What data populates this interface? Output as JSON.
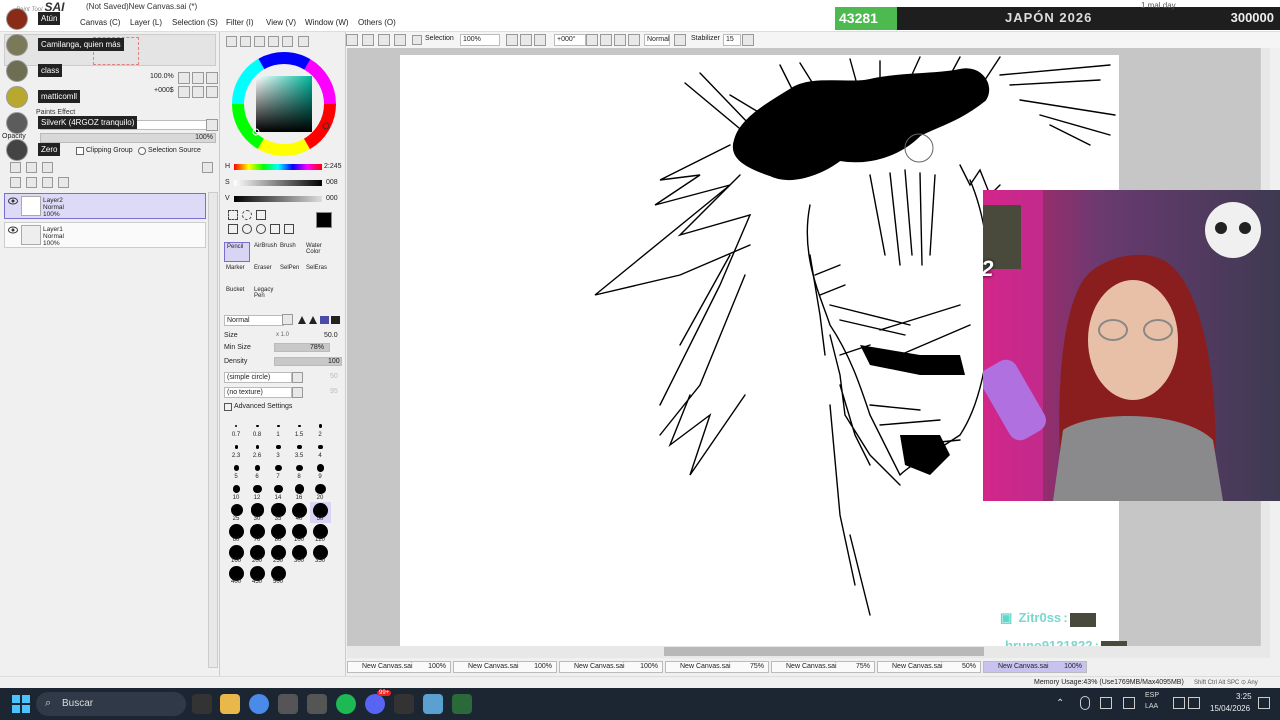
{
  "app": {
    "name": "SAI",
    "name_prefix": "Paint Tool",
    "title": "(Not Saved)New Canvas.sai (*)"
  },
  "menu": [
    "Canvas (C)",
    "Layer (L)",
    "Selection (S)",
    "Filter (I)",
    "View (V)",
    "Window (W)",
    "Others (O)"
  ],
  "overlay": {
    "count": "43281",
    "title": "JAPÓN 2026",
    "goal": "300000",
    "time_hint": "1 mal day"
  },
  "chat_names": [
    "Atún",
    "Camilanga, quien más",
    "class",
    "matticomll",
    "SilverK (4RGOZ tranquilo)",
    "Zero"
  ],
  "chat_feed": [
    {
      "name": "Zitr0ss"
    },
    {
      "name": "bruno9121822"
    }
  ],
  "combo_badge": "x2",
  "toolbar": {
    "selection_label": "Selection",
    "zoom": "100%",
    "rotation": "+000°",
    "blend": "Normal",
    "stabilizer_label": "Stabilizer",
    "stabilizer_value": "15"
  },
  "nav": {
    "zoom_value": "100.0%",
    "angle_value": "+000$",
    "opacity_label": "Opacity",
    "opacity_value": "100%",
    "effect_label": "Paints Effect",
    "clipping_label": "Clipping Group",
    "selection_source_label": "Selection Source"
  },
  "layers": [
    {
      "name": "Layer2",
      "mode": "Normal",
      "opacity": "100%",
      "active": true
    },
    {
      "name": "Layer1",
      "mode": "Normal",
      "opacity": "100%",
      "active": false
    }
  ],
  "color": {
    "h_label": "H",
    "h_value": "2:245",
    "s_label": "S",
    "s_value": "008",
    "v_label": "V",
    "v_value": "000",
    "current": "#000000"
  },
  "tools": [
    "Pencil",
    "AirBrush",
    "Brush",
    "Water Color",
    "Marker",
    "Eraser",
    "SelPen",
    "SelEras",
    "Bucket",
    "Legacy Pen"
  ],
  "brush": {
    "blend": "Normal",
    "size_label": "Size",
    "size_mult": "x 1.0",
    "size_value": "50.0",
    "min_size_label": "Min Size",
    "min_size_value": "78%",
    "density_label": "Density",
    "density_value": "100",
    "shape": "(simple circle)",
    "shape_value": "50",
    "texture": "(no texture)",
    "texture_value": "95",
    "advanced_label": "Advanced Settings"
  },
  "brush_sizes": [
    "0.7",
    "0.8",
    "1",
    "1.5",
    "2",
    "2.3",
    "2.6",
    "3",
    "3.5",
    "4",
    "5",
    "6",
    "7",
    "8",
    "9",
    "10",
    "12",
    "14",
    "16",
    "20",
    "25",
    "30",
    "35",
    "40",
    "50",
    "60",
    "70",
    "80",
    "100",
    "120",
    "160",
    "200",
    "250",
    "300",
    "350",
    "400",
    "450",
    "500"
  ],
  "canvas_tabs": [
    {
      "name": "New Canvas.sai",
      "zoom": "100%"
    },
    {
      "name": "New Canvas.sai",
      "zoom": "100%"
    },
    {
      "name": "New Canvas.sai",
      "zoom": "100%"
    },
    {
      "name": "New Canvas.sai",
      "zoom": "75%"
    },
    {
      "name": "New Canvas.sai",
      "zoom": "75%"
    },
    {
      "name": "New Canvas.sai",
      "zoom": "50%"
    },
    {
      "name": "New Canvas.sai",
      "zoom": "100%",
      "active": true
    }
  ],
  "status": {
    "memory": "Memory Usage:43% (Use1769MB/Max4095MB)",
    "keys": "Shift Ctrl Alt SPC ⊙ Any"
  },
  "taskbar": {
    "search": "Buscar",
    "lang": "ESP",
    "lang2": "LAA",
    "time": "3:25",
    "date": "15/04/2026",
    "badge": "99+"
  }
}
